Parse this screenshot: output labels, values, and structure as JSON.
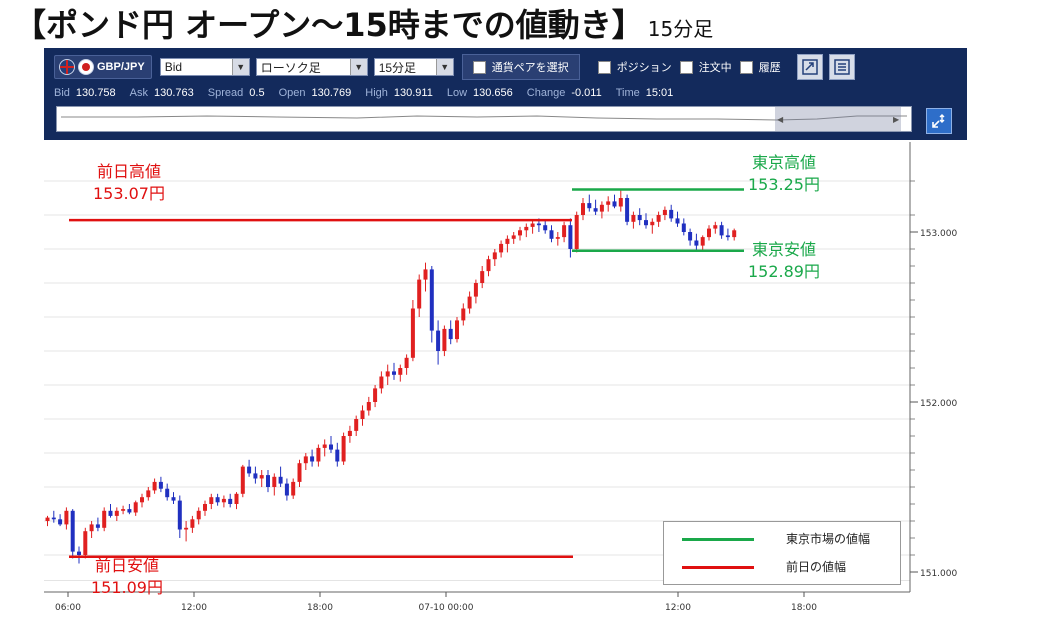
{
  "title": {
    "main": "【ポンド円 オープン～15時までの値動き】",
    "sub": "15分足"
  },
  "toolbar": {
    "pair": "GBP/JPY",
    "price_type": "Bid",
    "chart_type": "ローソク足",
    "timeframe": "15分足",
    "select_pair_button": "通貨ペアを選択",
    "checkboxes": [
      "ポジション",
      "注文中",
      "履歴"
    ],
    "quote": {
      "bid_label": "Bid",
      "bid": "130.758",
      "ask_label": "Ask",
      "ask": "130.763",
      "spread_label": "Spread",
      "spread": "0.5",
      "open_label": "Open",
      "open": "130.769",
      "high_label": "High",
      "high": "130.911",
      "low_label": "Low",
      "low": "130.656",
      "change_label": "Change",
      "change": "-0.011",
      "time_label": "Time",
      "time": "15:01"
    }
  },
  "annotations": {
    "prev_high_label": "前日高値",
    "prev_high_value": "153.07円",
    "prev_low_label": "前日安値",
    "prev_low_value": "151.09円",
    "tokyo_high_label": "東京高値",
    "tokyo_high_value": "153.25円",
    "tokyo_low_label": "東京安値",
    "tokyo_low_value": "152.89円"
  },
  "legend": {
    "tokyo": "東京市場の値幅",
    "prev": "前日の値幅"
  },
  "colors": {
    "up": "#e02020",
    "down": "#2030c0",
    "tokyo": "#1aa84a",
    "prev": "#e01010",
    "toolbar": "#132a5c"
  },
  "chart_data": {
    "type": "candlestick",
    "interval": "15分足",
    "y_ticks": [
      "153.000",
      "152.000",
      "151.000"
    ],
    "x_ticks": [
      "06:00",
      "12:00",
      "18:00",
      "07-10 00:00",
      "12:00",
      "18:00"
    ],
    "ylim": [
      150.92,
      153.48
    ],
    "levels": {
      "prev_high": 153.07,
      "prev_low": 151.09,
      "tokyo_high": 153.25,
      "tokyo_low": 152.89
    },
    "candles": [
      [
        151.3,
        151.33,
        151.27,
        151.32
      ],
      [
        151.32,
        151.36,
        151.29,
        151.31
      ],
      [
        151.31,
        151.34,
        151.27,
        151.28
      ],
      [
        151.28,
        151.38,
        151.25,
        151.36
      ],
      [
        151.36,
        151.37,
        151.08,
        151.12
      ],
      [
        151.12,
        151.15,
        151.05,
        151.1
      ],
      [
        151.1,
        151.26,
        151.08,
        151.24
      ],
      [
        151.24,
        151.3,
        151.2,
        151.28
      ],
      [
        151.28,
        151.32,
        151.24,
        151.26
      ],
      [
        151.26,
        151.38,
        151.24,
        151.36
      ],
      [
        151.36,
        151.4,
        151.32,
        151.33
      ],
      [
        151.33,
        151.38,
        151.3,
        151.36
      ],
      [
        151.36,
        151.39,
        151.34,
        151.37
      ],
      [
        151.37,
        151.4,
        151.34,
        151.35
      ],
      [
        151.35,
        151.42,
        151.33,
        151.41
      ],
      [
        151.41,
        151.46,
        151.38,
        151.44
      ],
      [
        151.44,
        151.5,
        151.42,
        151.48
      ],
      [
        151.48,
        151.55,
        151.46,
        151.53
      ],
      [
        151.53,
        151.56,
        151.47,
        151.49
      ],
      [
        151.49,
        151.52,
        151.42,
        151.44
      ],
      [
        151.44,
        151.47,
        151.4,
        151.42
      ],
      [
        151.42,
        151.45,
        151.2,
        151.25
      ],
      [
        151.25,
        151.3,
        151.18,
        151.26
      ],
      [
        151.26,
        151.33,
        151.23,
        151.31
      ],
      [
        151.31,
        151.38,
        151.28,
        151.36
      ],
      [
        151.36,
        151.42,
        151.33,
        151.4
      ],
      [
        151.4,
        151.46,
        151.37,
        151.44
      ],
      [
        151.44,
        151.46,
        151.39,
        151.41
      ],
      [
        151.41,
        151.45,
        151.38,
        151.43
      ],
      [
        151.43,
        151.46,
        151.38,
        151.4
      ],
      [
        151.4,
        151.47,
        151.37,
        151.46
      ],
      [
        151.46,
        151.63,
        151.44,
        151.62
      ],
      [
        151.62,
        151.66,
        151.56,
        151.58
      ],
      [
        151.58,
        151.62,
        151.52,
        151.55
      ],
      [
        151.55,
        151.6,
        151.5,
        151.57
      ],
      [
        151.57,
        151.6,
        151.47,
        151.5
      ],
      [
        151.5,
        151.58,
        151.45,
        151.56
      ],
      [
        151.56,
        151.62,
        151.5,
        151.52
      ],
      [
        151.52,
        151.55,
        151.42,
        151.45
      ],
      [
        151.45,
        151.55,
        151.43,
        151.53
      ],
      [
        151.53,
        151.66,
        151.5,
        151.64
      ],
      [
        151.64,
        151.7,
        151.6,
        151.68
      ],
      [
        151.68,
        151.72,
        151.62,
        151.65
      ],
      [
        151.65,
        151.75,
        151.62,
        151.73
      ],
      [
        151.73,
        151.78,
        151.68,
        151.75
      ],
      [
        151.75,
        151.8,
        151.7,
        151.72
      ],
      [
        151.72,
        151.76,
        151.62,
        151.65
      ],
      [
        151.65,
        151.82,
        151.63,
        151.8
      ],
      [
        151.8,
        151.86,
        151.76,
        151.83
      ],
      [
        151.83,
        151.92,
        151.8,
        151.9
      ],
      [
        151.9,
        151.98,
        151.86,
        151.95
      ],
      [
        151.95,
        152.03,
        151.92,
        152.0
      ],
      [
        152.0,
        152.1,
        151.97,
        152.08
      ],
      [
        152.08,
        152.18,
        152.05,
        152.15
      ],
      [
        152.15,
        152.22,
        152.1,
        152.18
      ],
      [
        152.18,
        152.23,
        152.13,
        152.16
      ],
      [
        152.16,
        152.22,
        152.12,
        152.2
      ],
      [
        152.2,
        152.28,
        152.16,
        152.26
      ],
      [
        152.26,
        152.6,
        152.24,
        152.55
      ],
      [
        152.55,
        152.75,
        152.5,
        152.72
      ],
      [
        152.72,
        152.82,
        152.65,
        152.78
      ],
      [
        152.78,
        152.8,
        152.35,
        152.42
      ],
      [
        152.42,
        152.48,
        152.22,
        152.3
      ],
      [
        152.3,
        152.45,
        152.27,
        152.43
      ],
      [
        152.43,
        152.48,
        152.34,
        152.37
      ],
      [
        152.37,
        152.5,
        152.35,
        152.48
      ],
      [
        152.48,
        152.58,
        152.45,
        152.55
      ],
      [
        152.55,
        152.65,
        152.52,
        152.62
      ],
      [
        152.62,
        152.72,
        152.58,
        152.7
      ],
      [
        152.7,
        152.8,
        152.67,
        152.77
      ],
      [
        152.77,
        152.86,
        152.74,
        152.84
      ],
      [
        152.84,
        152.9,
        152.8,
        152.88
      ],
      [
        152.88,
        152.95,
        152.85,
        152.93
      ],
      [
        152.93,
        152.98,
        152.88,
        152.96
      ],
      [
        152.96,
        153.0,
        152.93,
        152.98
      ],
      [
        152.98,
        153.03,
        152.95,
        153.01
      ],
      [
        153.01,
        153.05,
        152.97,
        153.03
      ],
      [
        153.03,
        153.07,
        152.99,
        153.05
      ],
      [
        153.05,
        153.08,
        153.0,
        153.04
      ],
      [
        153.04,
        153.07,
        152.99,
        153.01
      ],
      [
        153.01,
        153.04,
        152.94,
        152.96
      ],
      [
        152.96,
        153.0,
        152.92,
        152.97
      ],
      [
        152.97,
        153.06,
        152.94,
        153.04
      ],
      [
        153.04,
        153.08,
        152.85,
        152.9
      ],
      [
        152.9,
        153.12,
        152.88,
        153.1
      ],
      [
        153.1,
        153.2,
        153.07,
        153.17
      ],
      [
        153.17,
        153.22,
        153.12,
        153.14
      ],
      [
        153.14,
        153.19,
        153.1,
        153.12
      ],
      [
        153.12,
        153.18,
        153.08,
        153.16
      ],
      [
        153.16,
        153.21,
        153.12,
        153.18
      ],
      [
        153.18,
        153.22,
        153.14,
        153.15
      ],
      [
        153.15,
        153.25,
        153.12,
        153.2
      ],
      [
        153.2,
        153.22,
        153.04,
        153.06
      ],
      [
        153.06,
        153.12,
        153.02,
        153.1
      ],
      [
        153.1,
        153.14,
        153.04,
        153.07
      ],
      [
        153.07,
        153.11,
        153.02,
        153.04
      ],
      [
        153.04,
        153.08,
        152.99,
        153.06
      ],
      [
        153.06,
        153.12,
        153.03,
        153.1
      ],
      [
        153.1,
        153.15,
        153.07,
        153.13
      ],
      [
        153.13,
        153.16,
        153.06,
        153.08
      ],
      [
        153.08,
        153.12,
        153.03,
        153.05
      ],
      [
        153.05,
        153.08,
        152.98,
        153.0
      ],
      [
        153.0,
        153.02,
        152.92,
        152.95
      ],
      [
        152.95,
        152.99,
        152.89,
        152.92
      ],
      [
        152.92,
        152.98,
        152.89,
        152.97
      ],
      [
        152.97,
        153.04,
        152.95,
        153.02
      ],
      [
        153.02,
        153.06,
        152.99,
        153.04
      ],
      [
        153.04,
        153.06,
        152.96,
        152.98
      ],
      [
        152.98,
        153.02,
        152.95,
        152.97
      ],
      [
        152.97,
        153.02,
        152.95,
        153.01
      ]
    ]
  }
}
